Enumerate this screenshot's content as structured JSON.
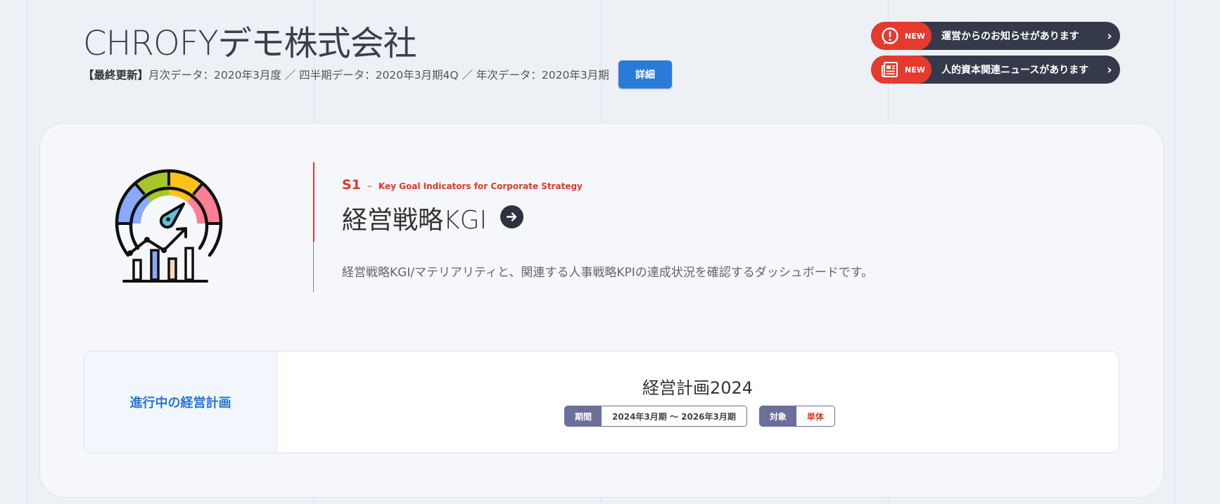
{
  "header": {
    "company": "CHROFYデモ株式会社",
    "update_label": "【最終更新】",
    "update_text": "月次データ：2020年3月度 ／ 四半期データ：2020年3月期4Q ／ 年次データ：2020年3月期",
    "detail_button": "詳細"
  },
  "notices": [
    {
      "badge": "NEW",
      "text": "運営からのお知らせがあります",
      "icon": "alert-icon"
    },
    {
      "badge": "NEW",
      "text": "人的資本関連ニュースがあります",
      "icon": "newspaper-icon"
    }
  ],
  "section": {
    "code": "S1",
    "dash": "–",
    "subtitle_en": "Key Goal Indicators for Corporate Strategy",
    "title": "経営戦略KGI",
    "description": "経営戦略KGI/マテリアリティと、関連する人事戦略KPIの達成状況を確認するダッシュボードです。",
    "icon": "gauge-chart-icon"
  },
  "plan": {
    "label": "進行中の経営計画",
    "name": "経営計画2024",
    "period_label": "期間",
    "period_value": "2024年3月期 〜 2026年3月期",
    "target_label": "対象",
    "target_value": "単体"
  },
  "colors": {
    "accent_red": "#e0382c",
    "accent_blue": "#2a7ad8",
    "notice_dark": "#353a4a",
    "tag_purple": "#6b6f9a"
  }
}
